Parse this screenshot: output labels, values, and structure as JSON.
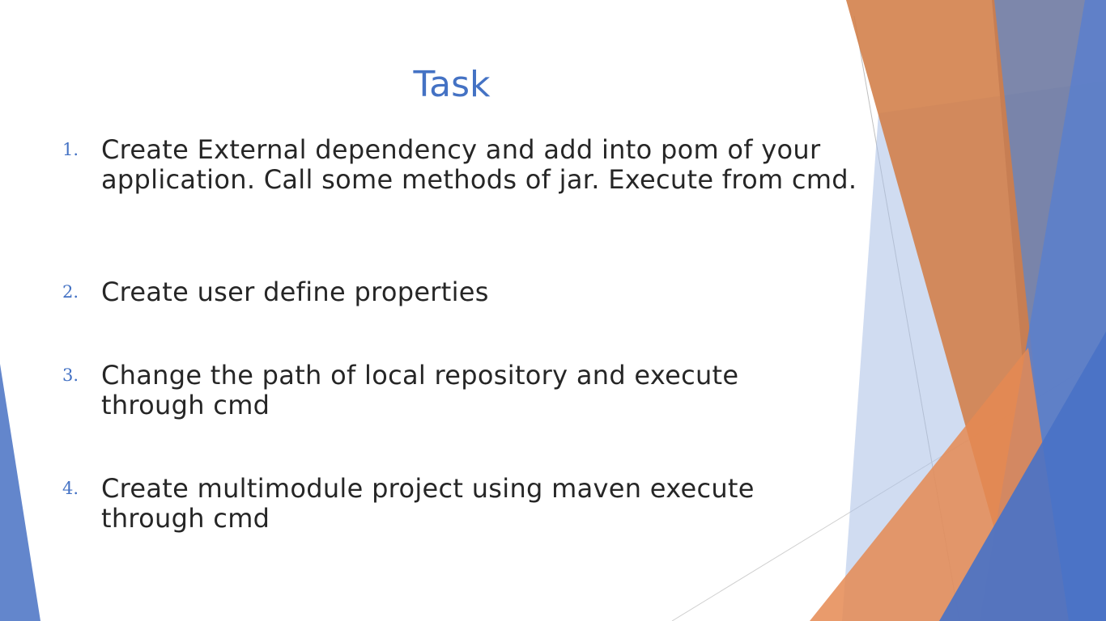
{
  "slide": {
    "title": "Task",
    "tasks": [
      {
        "number": "1.",
        "text": "Create External dependency and add into pom of your application. Call some methods of jar. Execute from cmd."
      },
      {
        "number": "2.",
        "text": "Create user define properties"
      },
      {
        "number": "3.",
        "text": "Change the path of local repository and execute through cmd"
      },
      {
        "number": "4.",
        "text": "Create multimodule project using maven execute through cmd"
      }
    ]
  },
  "colors": {
    "accent_blue": "#4472c4",
    "accent_orange": "#ed7d31",
    "text": "#262626",
    "background": "#ffffff"
  }
}
